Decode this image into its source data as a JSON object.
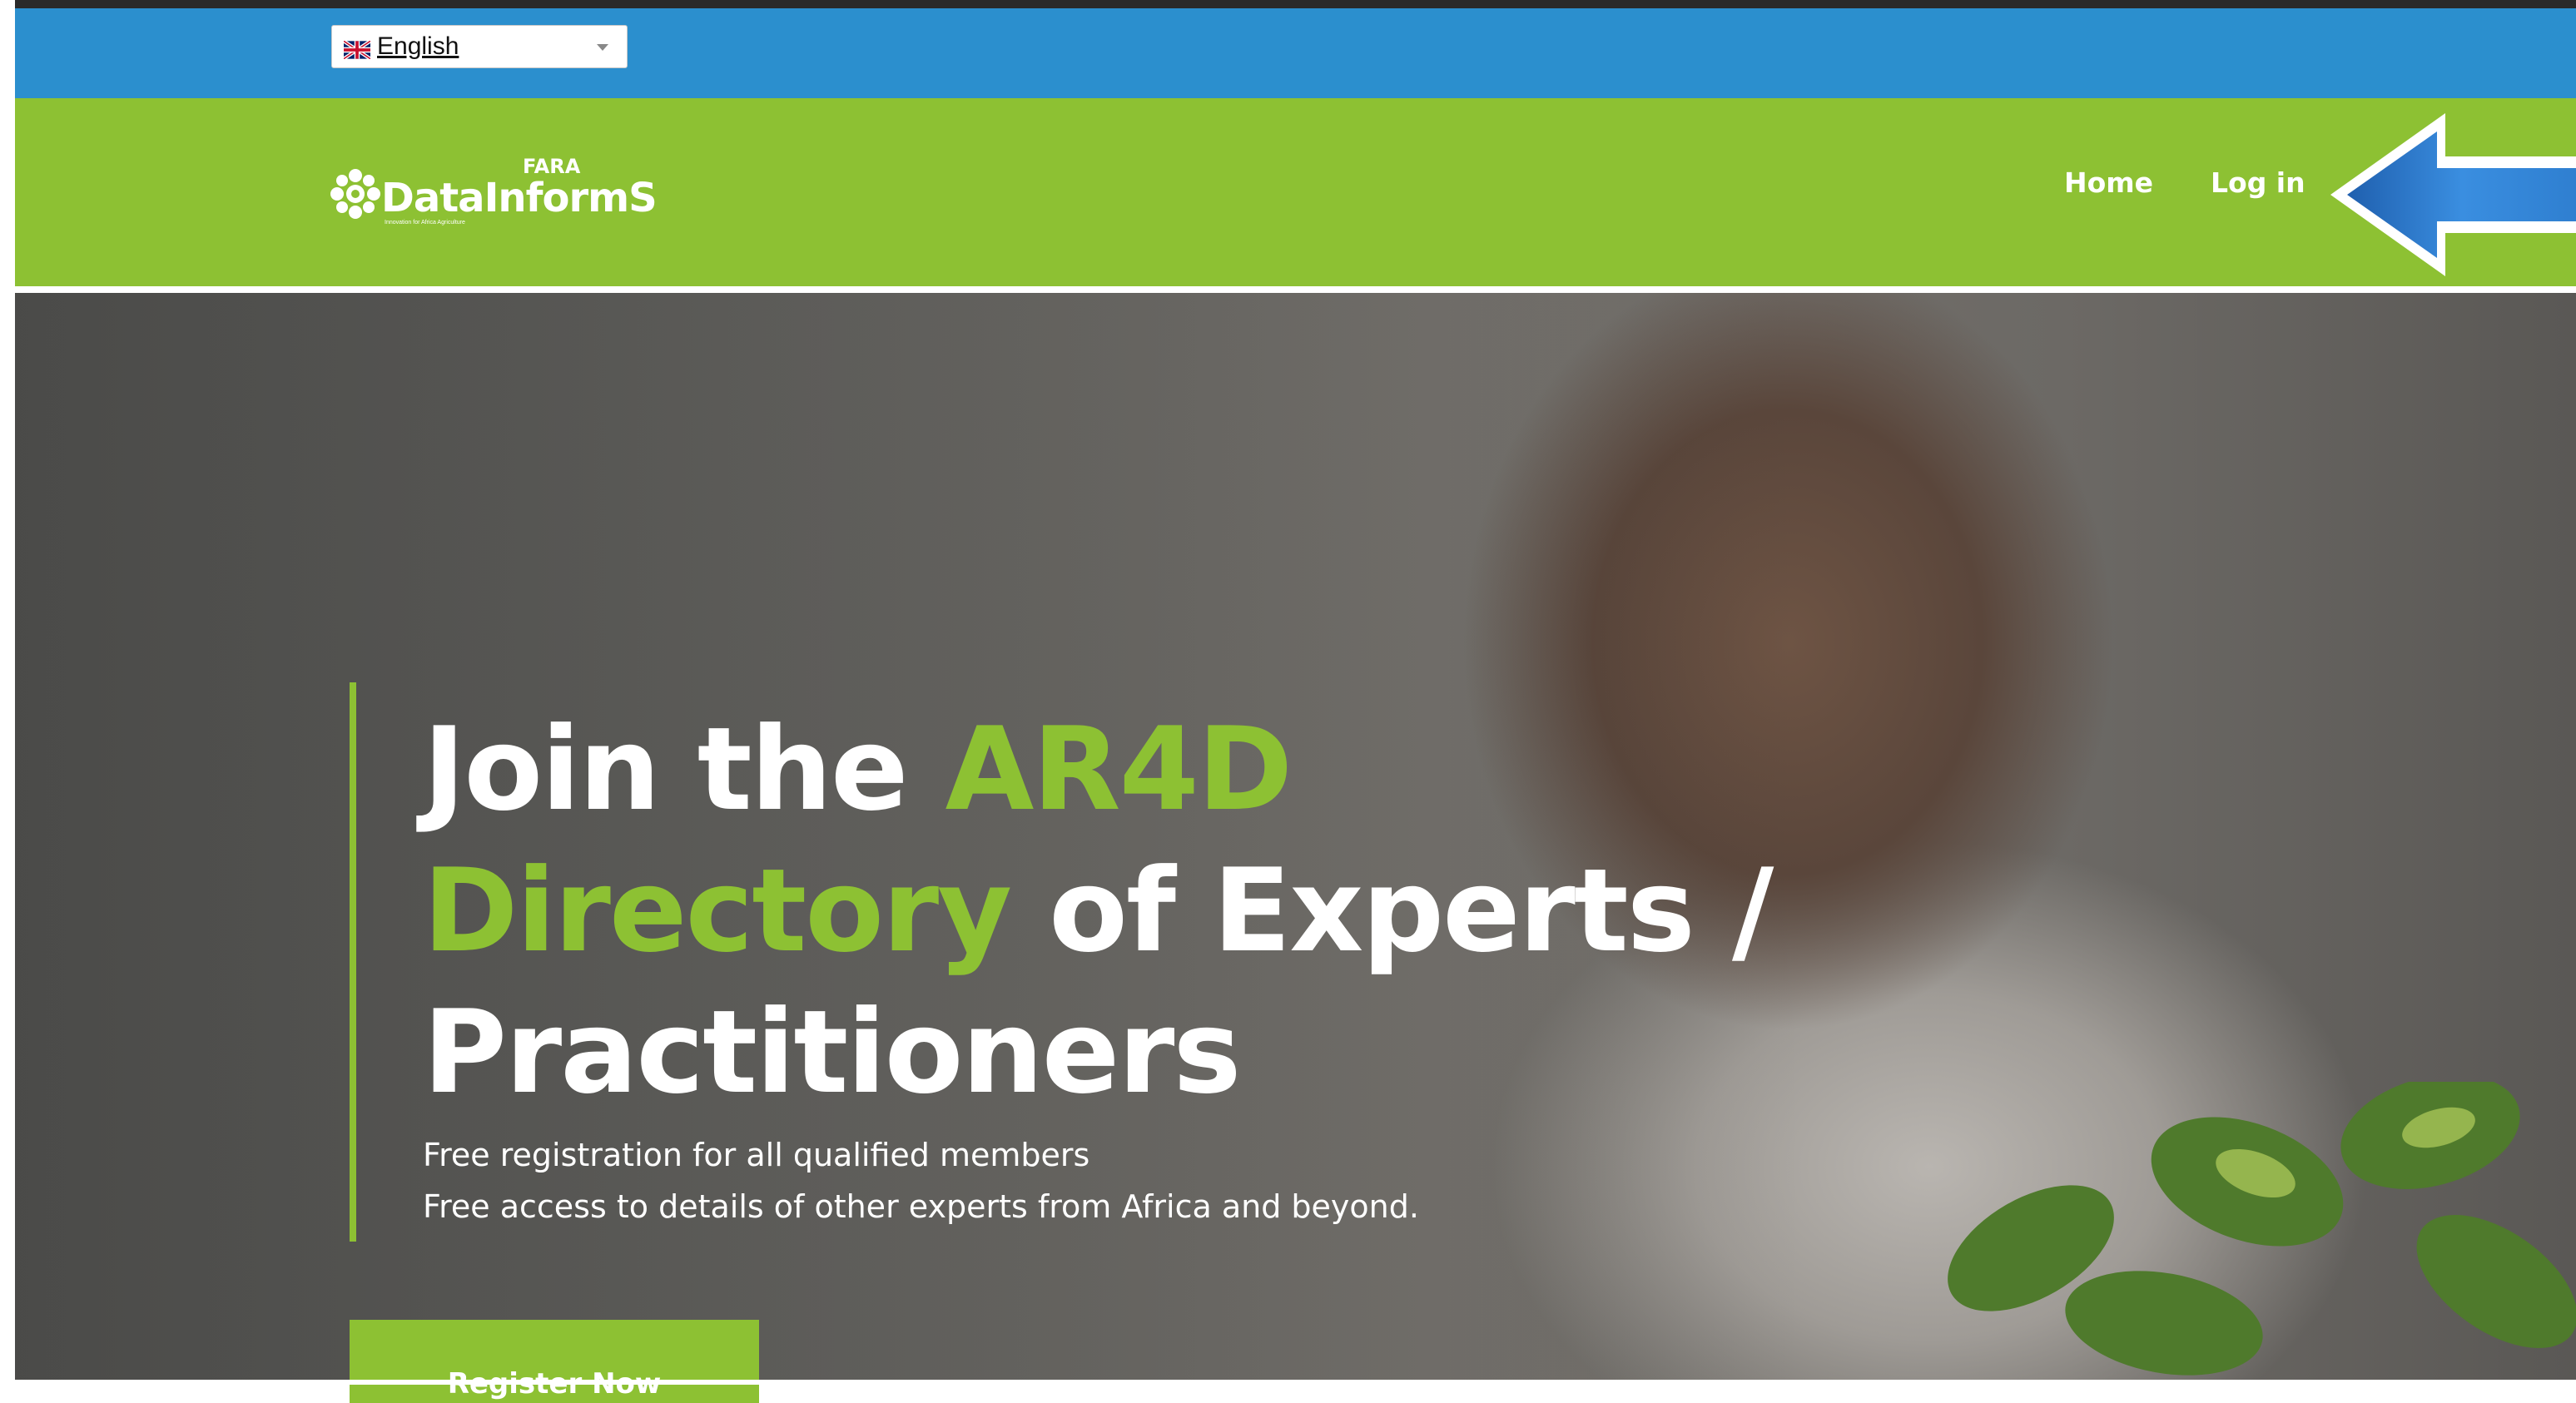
{
  "language": {
    "selected": "English",
    "flag_icon": "uk-flag-icon"
  },
  "logo": {
    "fara": "FARA",
    "name": "DataInformS",
    "tagline": "Innovation for Africa Agriculture"
  },
  "nav": {
    "home": "Home",
    "login": "Log in"
  },
  "hero": {
    "title_part1": "Join the ",
    "title_highlight1": "AR4D",
    "title_highlight2": "Directory",
    "title_part2": " of Experts /",
    "title_part3": "Practitioners",
    "sub1": "Free registration for all qualified members",
    "sub2": "Free access to details of other experts from Africa and beyond.",
    "cta": "Register Now"
  },
  "colors": {
    "top_bar": "#2b8fce",
    "brand_green": "#8dc133",
    "arrow_blue": "#2f7fd0"
  }
}
